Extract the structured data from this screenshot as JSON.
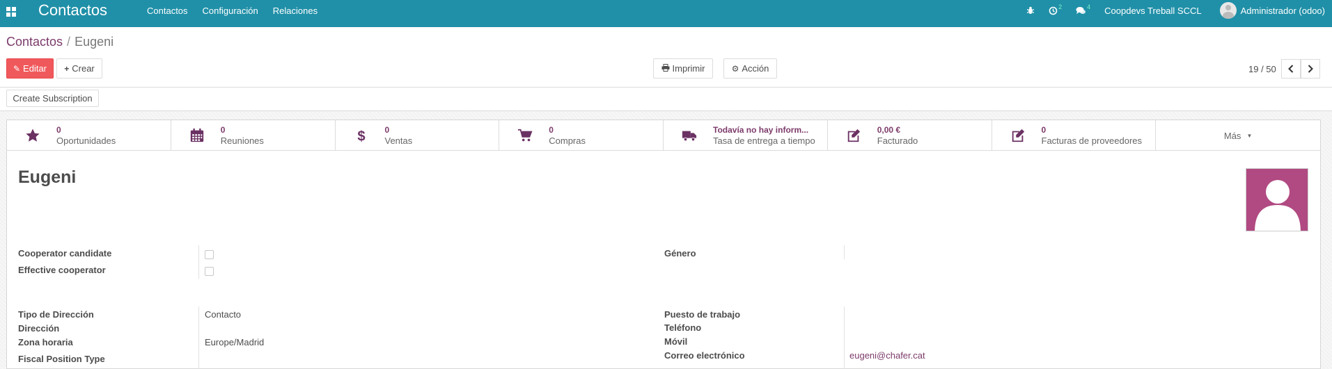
{
  "navbar": {
    "app_title": "Contactos",
    "menu": [
      "Contactos",
      "Configuración",
      "Relaciones"
    ],
    "activities_count": "2",
    "messages_count": "4",
    "company": "Coopdevs Treball SCCL",
    "user": "Administrador (odoo)",
    "bg_color": "#2090a8"
  },
  "breadcrumb": {
    "parent": "Contactos",
    "separator": "/",
    "current": "Eugeni"
  },
  "toolbar": {
    "edit_label": "Editar",
    "create_label": "Crear",
    "print_label": "Imprimir",
    "action_label": "Acción"
  },
  "pager": {
    "value": "19 / 50"
  },
  "header": {
    "subscription_label": "Create Subscription"
  },
  "stats": [
    {
      "icon": "star-icon",
      "value": "0",
      "label": "Oportunidades"
    },
    {
      "icon": "calendar-icon",
      "value": "0",
      "label": "Reuniones"
    },
    {
      "icon": "dollar-icon",
      "value": "0",
      "label": "Ventas"
    },
    {
      "icon": "cart-icon",
      "value": "0",
      "label": "Compras"
    },
    {
      "icon": "truck-icon",
      "value": "Todavía no hay inform...",
      "label": "Tasa de entrega a tiempo"
    },
    {
      "icon": "edit-icon",
      "value": "0,00 €",
      "label": "Facturado"
    },
    {
      "icon": "edit-icon",
      "value": "0",
      "label": "Facturas de proveedores"
    }
  ],
  "more_label": "Más",
  "partner": {
    "name": "Eugeni"
  },
  "fields_left": {
    "cooperator_candidate": "Cooperator candidate",
    "effective_cooperator": "Effective cooperator",
    "address_type_label": "Tipo de Dirección",
    "address_type_value": "Contacto",
    "address_label": "Dirección",
    "timezone_label": "Zona horaria",
    "timezone_value": "Europe/Madrid",
    "fiscal_position_type_label": "Fiscal Position Type"
  },
  "fields_right": {
    "gender_label": "Género",
    "job_label": "Puesto de trabajo",
    "phone_label": "Teléfono",
    "mobile_label": "Móvil",
    "email_label": "Correo electrónico",
    "email_value": "eugeni@chafer.cat"
  },
  "colors": {
    "accent": "#7c3a6a",
    "primary_button": "#f0595c",
    "avatar_bg": "#b14a82"
  }
}
